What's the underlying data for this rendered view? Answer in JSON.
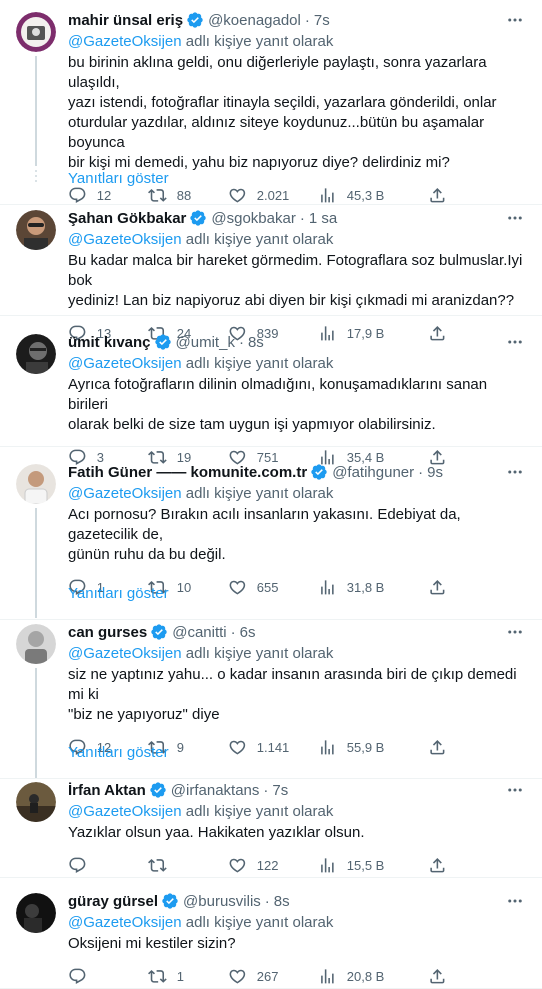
{
  "reply_prefix_suffix": "adlı kişiyeyanıt olarak",
  "tweets": [
    {
      "name": "mahir ünsal eriş",
      "verified": true,
      "handle": "@koenagadol",
      "time": "7s",
      "mention": "@GazeteOksijen",
      "reply_suffix": "adlı kişiye yanıt olarak",
      "text_lines": [
        "bu birinin aklına geldi, onu diğerleriyle paylaştı, sonra yazarlara ulaşıldı,",
        "yazı istendi, fotoğraflar itinayla seçildi, yazarlara gönderildi, onlar",
        "oturdular yazdılar, aldınız siteye koydunuz...bütün bu aşamalar boyunca",
        "bir kişi mi demedi, yahu biz napıyoruz diye? delirdiniz mi?"
      ],
      "replies": "12",
      "retweets": "88",
      "likes": "2.021",
      "views": "45,3 B",
      "avatar_color": "#8a3b7a"
    },
    {
      "name": "Şahan Gökbakar",
      "verified": true,
      "handle": "@sgokbakar",
      "time": "1 sa",
      "mention": "@GazeteOksijen",
      "reply_suffix": "adlı kişiye yanıt olarak",
      "text_lines": [
        "Bu kadar malca bir hareket görmedim. Fotograflara soz bulmuslar.Iyi bok",
        "yediniz! Lan biz napiyoruz abi diyen bir kişi çıkmadi mi aranizdan??"
      ],
      "replies": "13",
      "retweets": "24",
      "likes": "839",
      "views": "17,9 B",
      "avatar_color": "#3a2a20"
    },
    {
      "name": "ümit kıvanç",
      "verified": true,
      "handle": "@umit_k",
      "time": "8s",
      "mention": "@GazeteOksijen",
      "reply_suffix": "adlı kişiye yanıt olarak",
      "text_lines": [
        "Ayrıca fotoğrafların dilinin olmadığını, konuşamadıklarını sanan birileri",
        "olarak belki de size tam uygun işi yapmıyor olabilirsiniz."
      ],
      "replies": "3",
      "retweets": "19",
      "likes": "751",
      "views": "35,4 B",
      "avatar_color": "#2b2b2b"
    },
    {
      "name": "Fatih Güner —— komunite.com.tr",
      "verified": true,
      "handle": "@fatihguner",
      "time": "9s",
      "mention": "@GazeteOksijen",
      "reply_suffix": "adlı kişiye yanıt olarak",
      "text_lines": [
        "Acı pornosu? Bırakın acılı insanların yakasını. Edebiyat da, gazetecilik de,",
        "günün ruhu da bu değil."
      ],
      "replies": "1",
      "retweets": "10",
      "likes": "655",
      "views": "31,8 B",
      "avatar_color": "#d9d4cf"
    },
    {
      "name": "can gurses",
      "verified": true,
      "handle": "@canitti",
      "time": "6s",
      "mention": "@GazeteOksijen",
      "reply_suffix": "adlı kişiye yanıt olarak",
      "text_lines": [
        "siz ne yaptınız yahu... o kadar insanın arasında biri de çıkıp demedi mi ki",
        "\"biz ne yapıyoruz\" diye"
      ],
      "replies": "12",
      "retweets": "9",
      "likes": "1.141",
      "views": "55,9 B",
      "avatar_color": "#bdbdbd"
    },
    {
      "name": "İrfan Aktan",
      "verified": true,
      "handle": "@irfanaktans",
      "time": "7s",
      "mention": "@GazeteOksijen",
      "reply_suffix": "adlı kişiye yanıt olarak",
      "text_lines": [
        "Yazıklar olsun yaa. Hakikaten yazıklar olsun."
      ],
      "replies": "",
      "retweets": "",
      "likes": "122",
      "views": "15,5 B",
      "avatar_color": "#5a4a34"
    },
    {
      "name": "güray gürsel",
      "verified": true,
      "handle": "@burusvilis",
      "time": "8s",
      "mention": "@GazeteOksijen",
      "reply_suffix": "adlı kişiye yanıt olarak",
      "text_lines": [
        "Oksijeni mi kestiler sizin?"
      ],
      "replies": "",
      "retweets": "1",
      "likes": "267",
      "views": "20,8 B",
      "avatar_color": "#1e1e1e"
    }
  ],
  "show_replies_label": "Yanıtları göster",
  "colors": {
    "accent": "#1d9bf0",
    "secondary_text": "#536471",
    "divider": "#eff3f4"
  },
  "icons": {
    "reply": "reply-icon",
    "retweet": "retweet-icon",
    "like": "heart-icon",
    "views": "views-icon",
    "share": "share-icon",
    "more": "more-icon",
    "verified": "verified-badge-icon"
  }
}
